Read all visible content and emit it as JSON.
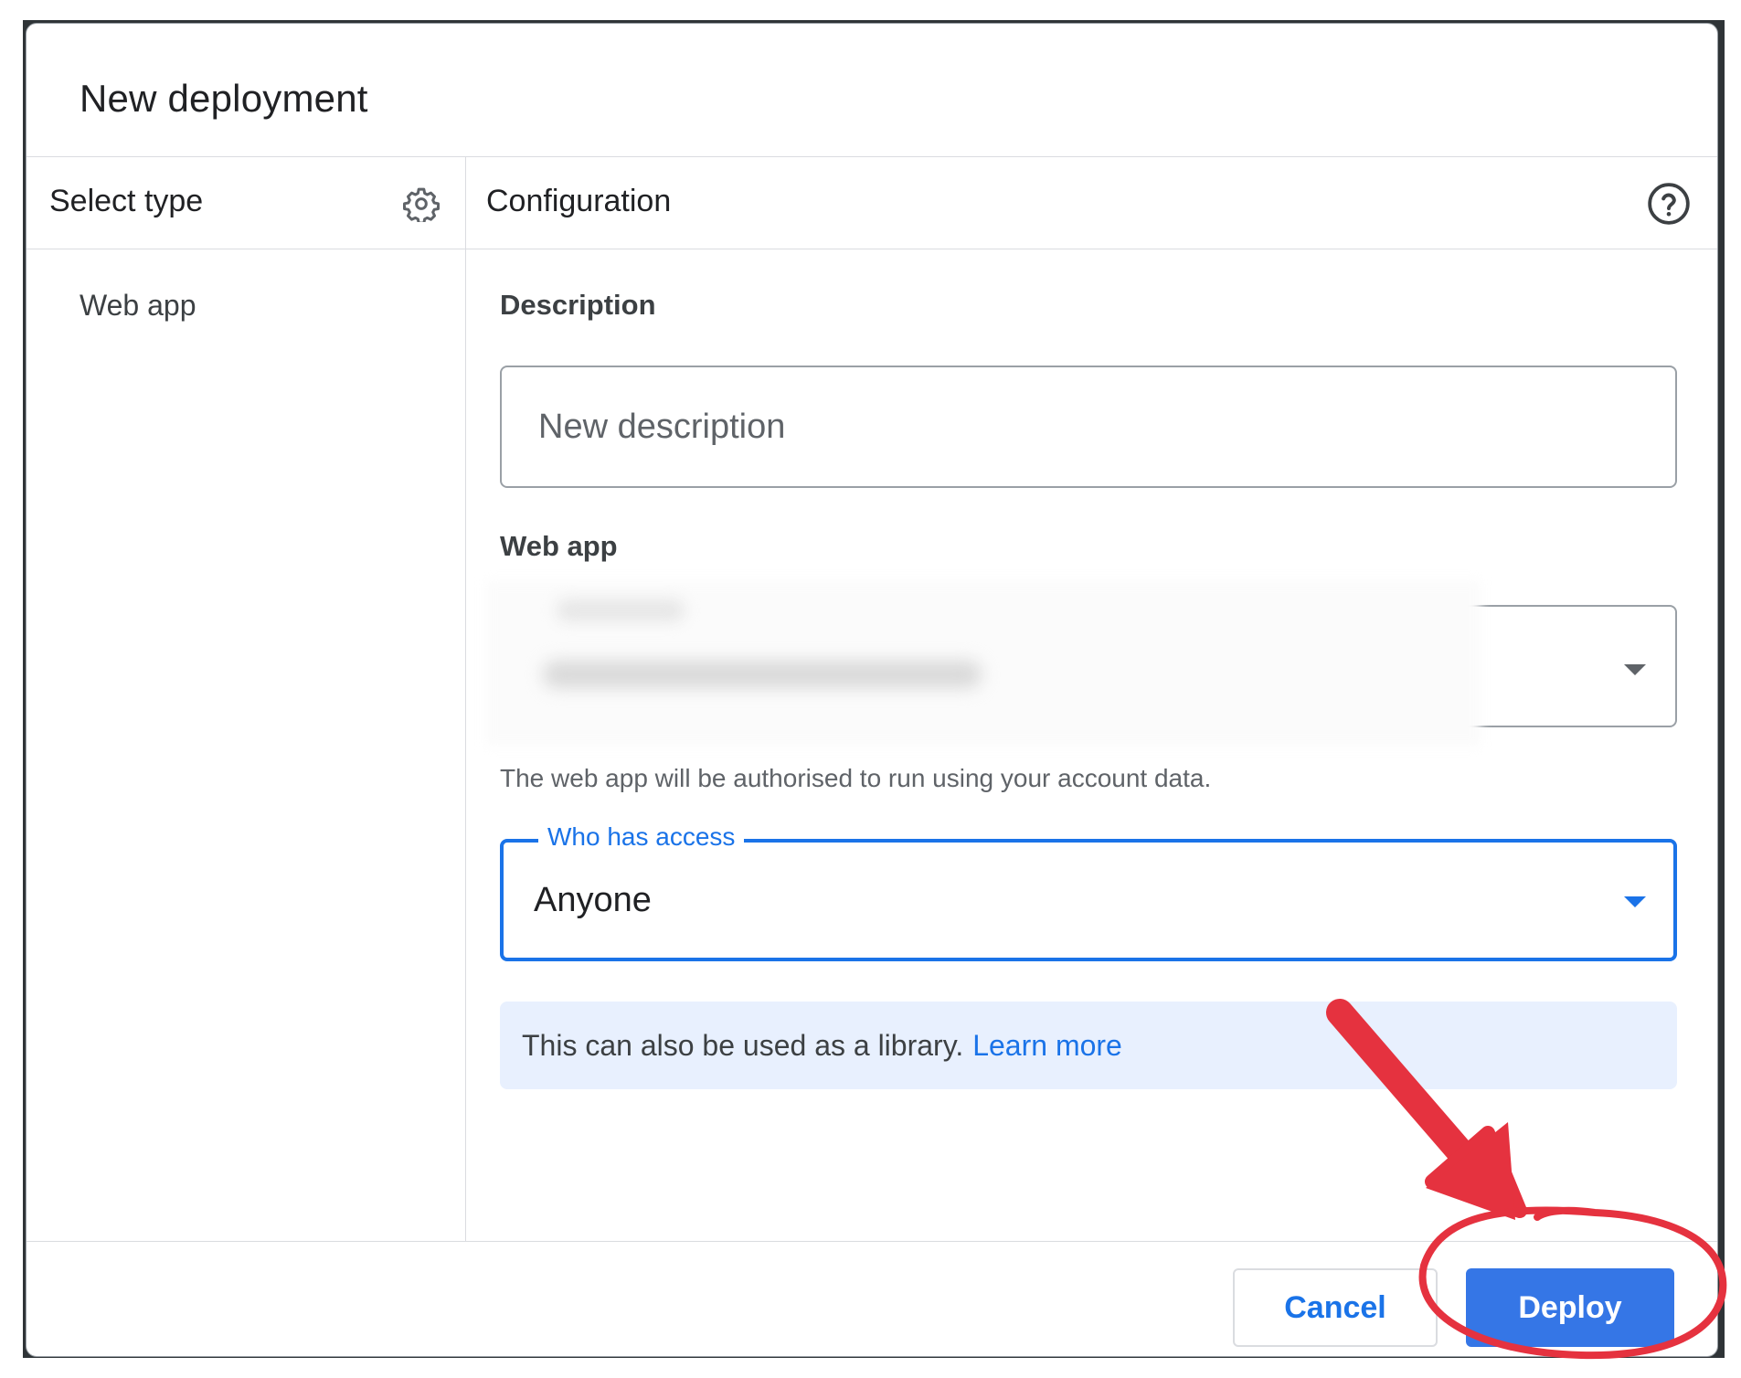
{
  "dialog": {
    "title": "New deployment"
  },
  "sidebar": {
    "header": "Select type",
    "settings_icon": "gear-icon",
    "items": [
      {
        "label": "Web app"
      }
    ]
  },
  "main": {
    "header": "Configuration",
    "help_icon": "help-circle-icon",
    "description": {
      "label": "Description",
      "placeholder": "New description",
      "value": ""
    },
    "web_app": {
      "label": "Web app",
      "execute_as_redacted": true,
      "helper_text": "The web app will be authorised to run using your account data."
    },
    "access": {
      "label": "Who has access",
      "value": "Anyone",
      "accent": "#1a73e8"
    },
    "info": {
      "text": "This can also be used as a library.",
      "link": "Learn more",
      "background": "#e8f0fe"
    }
  },
  "footer": {
    "cancel_label": "Cancel",
    "deploy_label": "Deploy",
    "deploy_color": "#3576e6"
  },
  "annotation": {
    "color": "#e5323f",
    "shapes": [
      "arrow",
      "circle"
    ]
  }
}
